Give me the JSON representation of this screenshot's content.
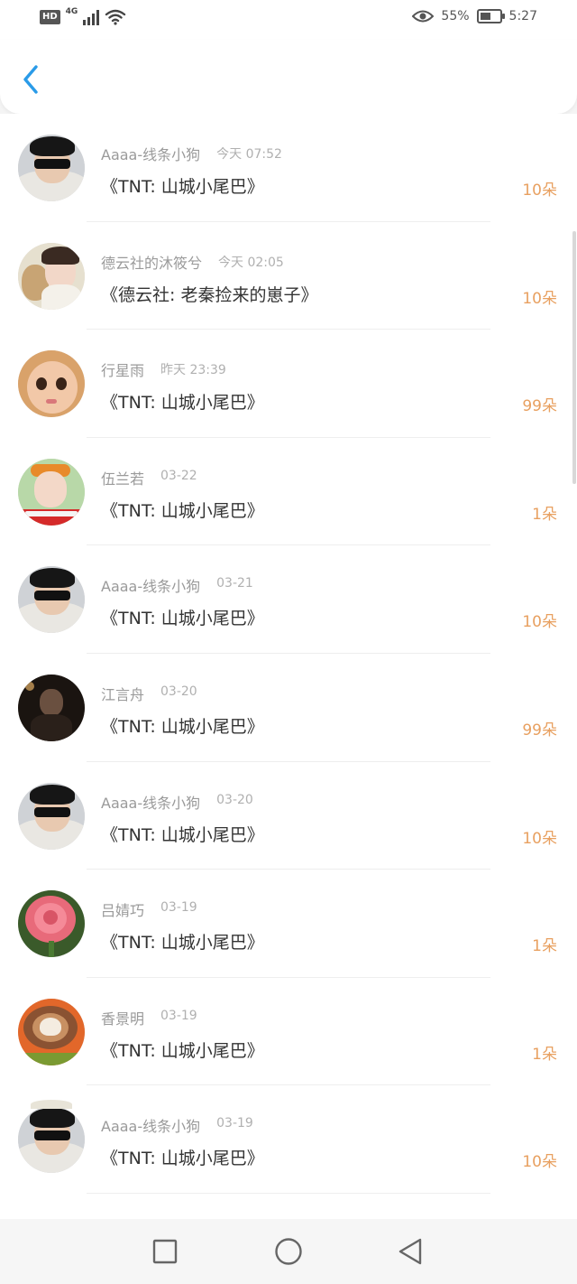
{
  "status_bar": {
    "hd_badge": "HD",
    "network": "4G",
    "battery_percent": "55%",
    "battery_level": 0.55,
    "time": "5:27",
    "icons": [
      "signal-icon",
      "wifi-icon",
      "eye-icon",
      "battery-icon"
    ]
  },
  "header": {
    "back_icon": "chevron-left-icon",
    "accent_color": "#2a9be8"
  },
  "records": [
    {
      "name": "Aaaa-线条小狗",
      "time": "今天 07:52",
      "title": "《TNT: 山城小尾巴》",
      "count": "10朵",
      "avatar": "boy-sunglasses"
    },
    {
      "name": "德云社的沐筱兮",
      "time": "今天 02:05",
      "title": "《德云社: 老秦捡来的崽子》",
      "count": "10朵",
      "avatar": "girl-teddy-bear"
    },
    {
      "name": "行星雨",
      "time": "昨天 23:39",
      "title": "《TNT: 山城小尾巴》",
      "count": "99朵",
      "avatar": "doll-face"
    },
    {
      "name": "伍兰若",
      "time": "03-22",
      "title": "《TNT: 山城小尾巴》",
      "count": "1朵",
      "avatar": "girl-headband"
    },
    {
      "name": "Aaaa-线条小狗",
      "time": "03-21",
      "title": "《TNT: 山城小尾巴》",
      "count": "10朵",
      "avatar": "boy-sunglasses"
    },
    {
      "name": "江言舟",
      "time": "03-20",
      "title": "《TNT: 山城小尾巴》",
      "count": "99朵",
      "avatar": "dark-portrait"
    },
    {
      "name": "Aaaa-线条小狗",
      "time": "03-20",
      "title": "《TNT: 山城小尾巴》",
      "count": "10朵",
      "avatar": "boy-sunglasses"
    },
    {
      "name": "吕婧巧",
      "time": "03-19",
      "title": "《TNT: 山城小尾巴》",
      "count": "1朵",
      "avatar": "pink-rose"
    },
    {
      "name": "香景明",
      "time": "03-19",
      "title": "《TNT: 山城小尾巴》",
      "count": "1朵",
      "avatar": "latte-heart"
    },
    {
      "name": "Aaaa-线条小狗",
      "time": "03-19",
      "title": "《TNT: 山城小尾巴》",
      "count": "10朵",
      "avatar": "boy-sunglasses"
    }
  ],
  "colors": {
    "count": "#e8a060",
    "name": "#9a9a9a",
    "title": "#333333"
  },
  "nav_bar": {
    "icons": [
      "square-icon",
      "circle-icon",
      "triangle-back-icon"
    ]
  }
}
